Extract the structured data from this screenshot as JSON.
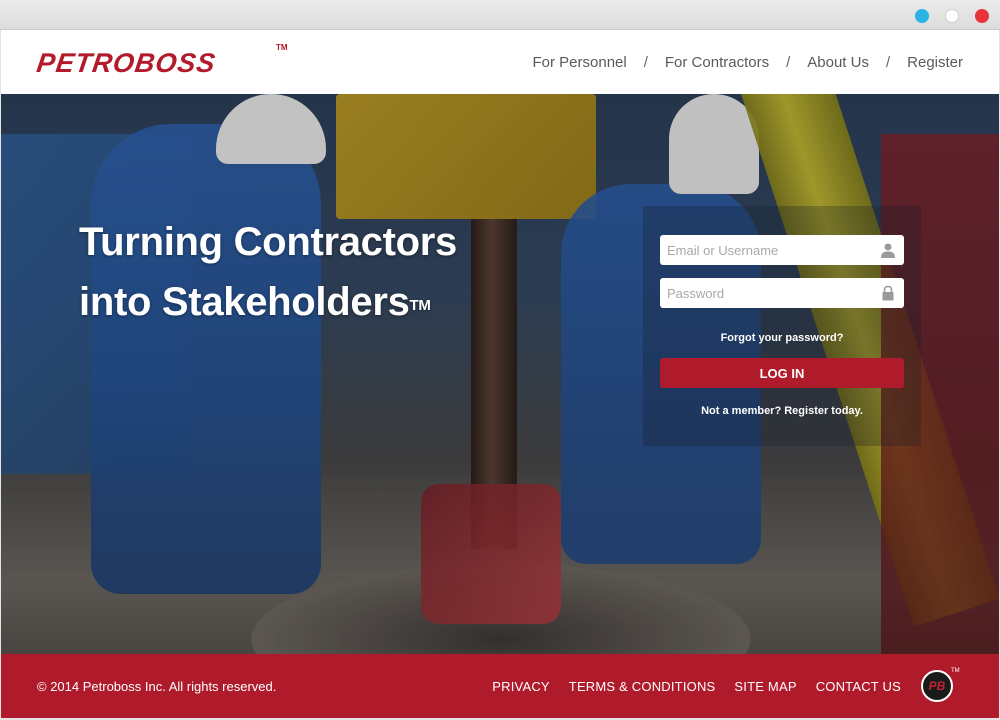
{
  "window": {
    "controls": [
      "blue-dot",
      "white-dot",
      "red-dot"
    ]
  },
  "header": {
    "logo_text": "PETROBOSS",
    "logo_tm": "TM",
    "nav": [
      {
        "label": "For Personnel"
      },
      {
        "label": "For Contractors"
      },
      {
        "label": "About Us"
      },
      {
        "label": "Register"
      }
    ],
    "separator": "/"
  },
  "hero": {
    "headline_line1": "Turning Contractors",
    "headline_line2": "into Stakeholders",
    "headline_tm": "TM"
  },
  "login": {
    "username_placeholder": "Email or Username",
    "username_value": "",
    "password_placeholder": "Password",
    "password_value": "",
    "forgot_label": "Forgot your password?",
    "button_label": "LOG IN",
    "register_label": "Not a member? Register today."
  },
  "footer": {
    "copyright": "© 2014 Petroboss Inc. All rights reserved.",
    "links": [
      {
        "label": "PRIVACY"
      },
      {
        "label": "TERMS & CONDITIONS"
      },
      {
        "label": "SITE MAP"
      },
      {
        "label": "CONTACT US"
      }
    ],
    "badge_text": "PB",
    "badge_tm": "TM"
  },
  "colors": {
    "brand_red": "#b01b2c",
    "logo_red": "#b31a2b",
    "nav_text": "#5a5a5a",
    "white": "#ffffff"
  },
  "icons": {
    "username": "user-icon",
    "password": "lock-icon"
  }
}
